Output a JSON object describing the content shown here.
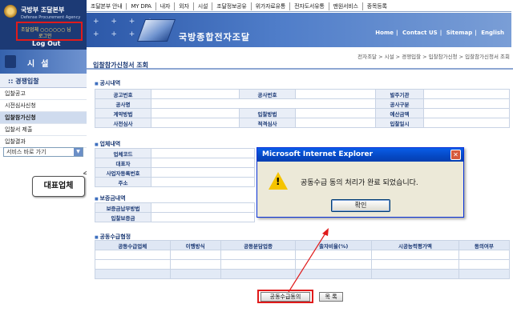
{
  "topmenu": [
    "조달본부 안내",
    "MY DPA",
    "내자",
    "외자",
    "시설",
    "조달정보공유",
    "위가자료유통",
    "전자도서유통",
    "맨원서비스",
    "종목등록"
  ],
  "logo": {
    "title": "국방부 조달본부",
    "subtitle": "Defense Procurement Agency"
  },
  "banner": {
    "stars": "+ + + +",
    "agency": "국방종합전자조달",
    "links": [
      "Home",
      "Contact US",
      "Sitemap",
      "English"
    ]
  },
  "user": {
    "line1": "조달업체 ○○○○○○ 님",
    "line2": "로그인",
    "logout": "Log Out"
  },
  "sidebar": {
    "title": "시설",
    "subtitle": ":: 경쟁입찰",
    "items": [
      "입찰공고",
      "시전심사신청",
      "입찰참가신청",
      "입찰서 제출",
      "입찰결과"
    ],
    "select": "서비스 바로 가기"
  },
  "callout": "대표업체",
  "main": {
    "title": "입찰참가신청서 조회",
    "breadcrumb": "전자조달 > 시설 > 경쟁입찰 > 입찰참가신청 > 입찰참가신청서 조회",
    "sec_notice": "공시내역",
    "notice": {
      "r1": [
        "공고번호",
        "",
        "공사번호",
        "",
        "발주기관",
        ""
      ],
      "r2": [
        "공사명",
        "",
        "",
        "",
        "공사구분",
        ""
      ],
      "r3": [
        "계약방법",
        "",
        "입찰방법",
        "",
        "예산금액",
        ""
      ],
      "r4": [
        "사전심사",
        "",
        "적격심사",
        "",
        "입찰일시",
        ""
      ]
    },
    "sec_company": "업체내역",
    "company": [
      "업체코드",
      "대표자",
      "사업자등록번호",
      "주소"
    ],
    "sec_bond": "보증금내역",
    "bond": [
      "보증금납부방법",
      "입찰보증금"
    ],
    "sec_joint": "공동수급협정",
    "joint_headers": [
      "공동수급업체",
      "이행방식",
      "공동분담업종",
      "출자비율(%)",
      "시공능력평가액",
      "동의여부"
    ],
    "joint_rows": [
      [
        "",
        "",
        "",
        "",
        "",
        ""
      ],
      [
        "",
        "",
        "",
        "",
        "",
        ""
      ],
      [
        "",
        "",
        "",
        "",
        "",
        ""
      ]
    ],
    "btn_agree": "공동수급동의",
    "btn_list": "목 록"
  },
  "dialog": {
    "title": "Microsoft Internet Explorer",
    "message": "공동수급 동의 처리가 완료 되었습니다.",
    "ok": "확인",
    "icon": "!"
  }
}
